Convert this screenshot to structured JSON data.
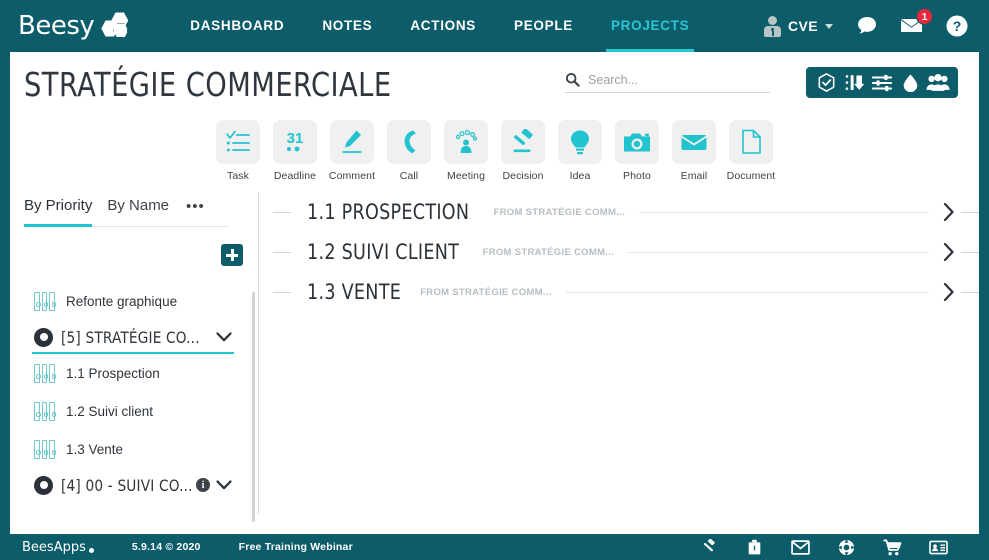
{
  "brand": {
    "logo_text": "Beesy",
    "accent": "#21c3cf",
    "header_bg": "#0d5c69"
  },
  "topnav": {
    "links": [
      {
        "label": "DASHBOARD",
        "active": false
      },
      {
        "label": "NOTES",
        "active": false
      },
      {
        "label": "ACTIONS",
        "active": false
      },
      {
        "label": "PEOPLE",
        "active": false
      },
      {
        "label": "PROJECTS",
        "active": true
      }
    ],
    "user": {
      "name": "CVE"
    },
    "mail_badge": "1"
  },
  "page": {
    "title": "STRATÉGIE COMMERCIALE",
    "search": {
      "placeholder": "Search...",
      "value": ""
    },
    "tools": [
      {
        "name": "validate-shield-icon"
      },
      {
        "name": "sort-icon"
      },
      {
        "name": "filter-icon"
      },
      {
        "name": "export-icon"
      },
      {
        "name": "team-icon"
      }
    ]
  },
  "action_types": [
    {
      "label": "Task",
      "icon": "task-icon"
    },
    {
      "label": "Deadline",
      "icon": "calendar-icon",
      "day": "31"
    },
    {
      "label": "Comment",
      "icon": "pen-icon"
    },
    {
      "label": "Call",
      "icon": "phone-icon"
    },
    {
      "label": "Meeting",
      "icon": "meeting-icon"
    },
    {
      "label": "Decision",
      "icon": "gavel-icon"
    },
    {
      "label": "Idea",
      "icon": "bulb-icon"
    },
    {
      "label": "Photo",
      "icon": "camera-icon"
    },
    {
      "label": "Email",
      "icon": "envelope-icon"
    },
    {
      "label": "Document",
      "icon": "document-icon"
    }
  ],
  "sidebar": {
    "tabs": [
      {
        "label": "By Priority",
        "active": true
      },
      {
        "label": "By Name",
        "active": false
      }
    ],
    "more_label": "•••",
    "items": [
      {
        "label": "Refonte graphique",
        "type": "binder"
      },
      {
        "label": "[5] STRATÉGIE CO...",
        "type": "project",
        "selected": true,
        "has_info": false
      },
      {
        "label": "1.1 Prospection",
        "type": "binder"
      },
      {
        "label": "1.2 Suivi client",
        "type": "binder"
      },
      {
        "label": "1.3 Vente",
        "type": "binder"
      },
      {
        "label": "[4] 00 - SUIVI CO...",
        "type": "project",
        "selected": false,
        "has_info": true
      }
    ]
  },
  "main": {
    "rows": [
      {
        "title": "1.1 PROSPECTION",
        "subtitle": "FROM STRATÉGIE COMM..."
      },
      {
        "title": "1.2 SUIVI CLIENT",
        "subtitle": "FROM STRATÉGIE COMM..."
      },
      {
        "title": "1.3 VENTE",
        "subtitle": "FROM STRATÉGIE COMM..."
      }
    ]
  },
  "footer": {
    "logo_text": "BeesApps",
    "version": "5.9.14 © 2020",
    "promo": "Free Training Webinar",
    "icons": [
      {
        "name": "hammer-icon"
      },
      {
        "name": "briefcase-icon"
      },
      {
        "name": "envelope-icon"
      },
      {
        "name": "support-icon"
      },
      {
        "name": "cart-icon"
      },
      {
        "name": "contact-card-icon"
      }
    ]
  }
}
